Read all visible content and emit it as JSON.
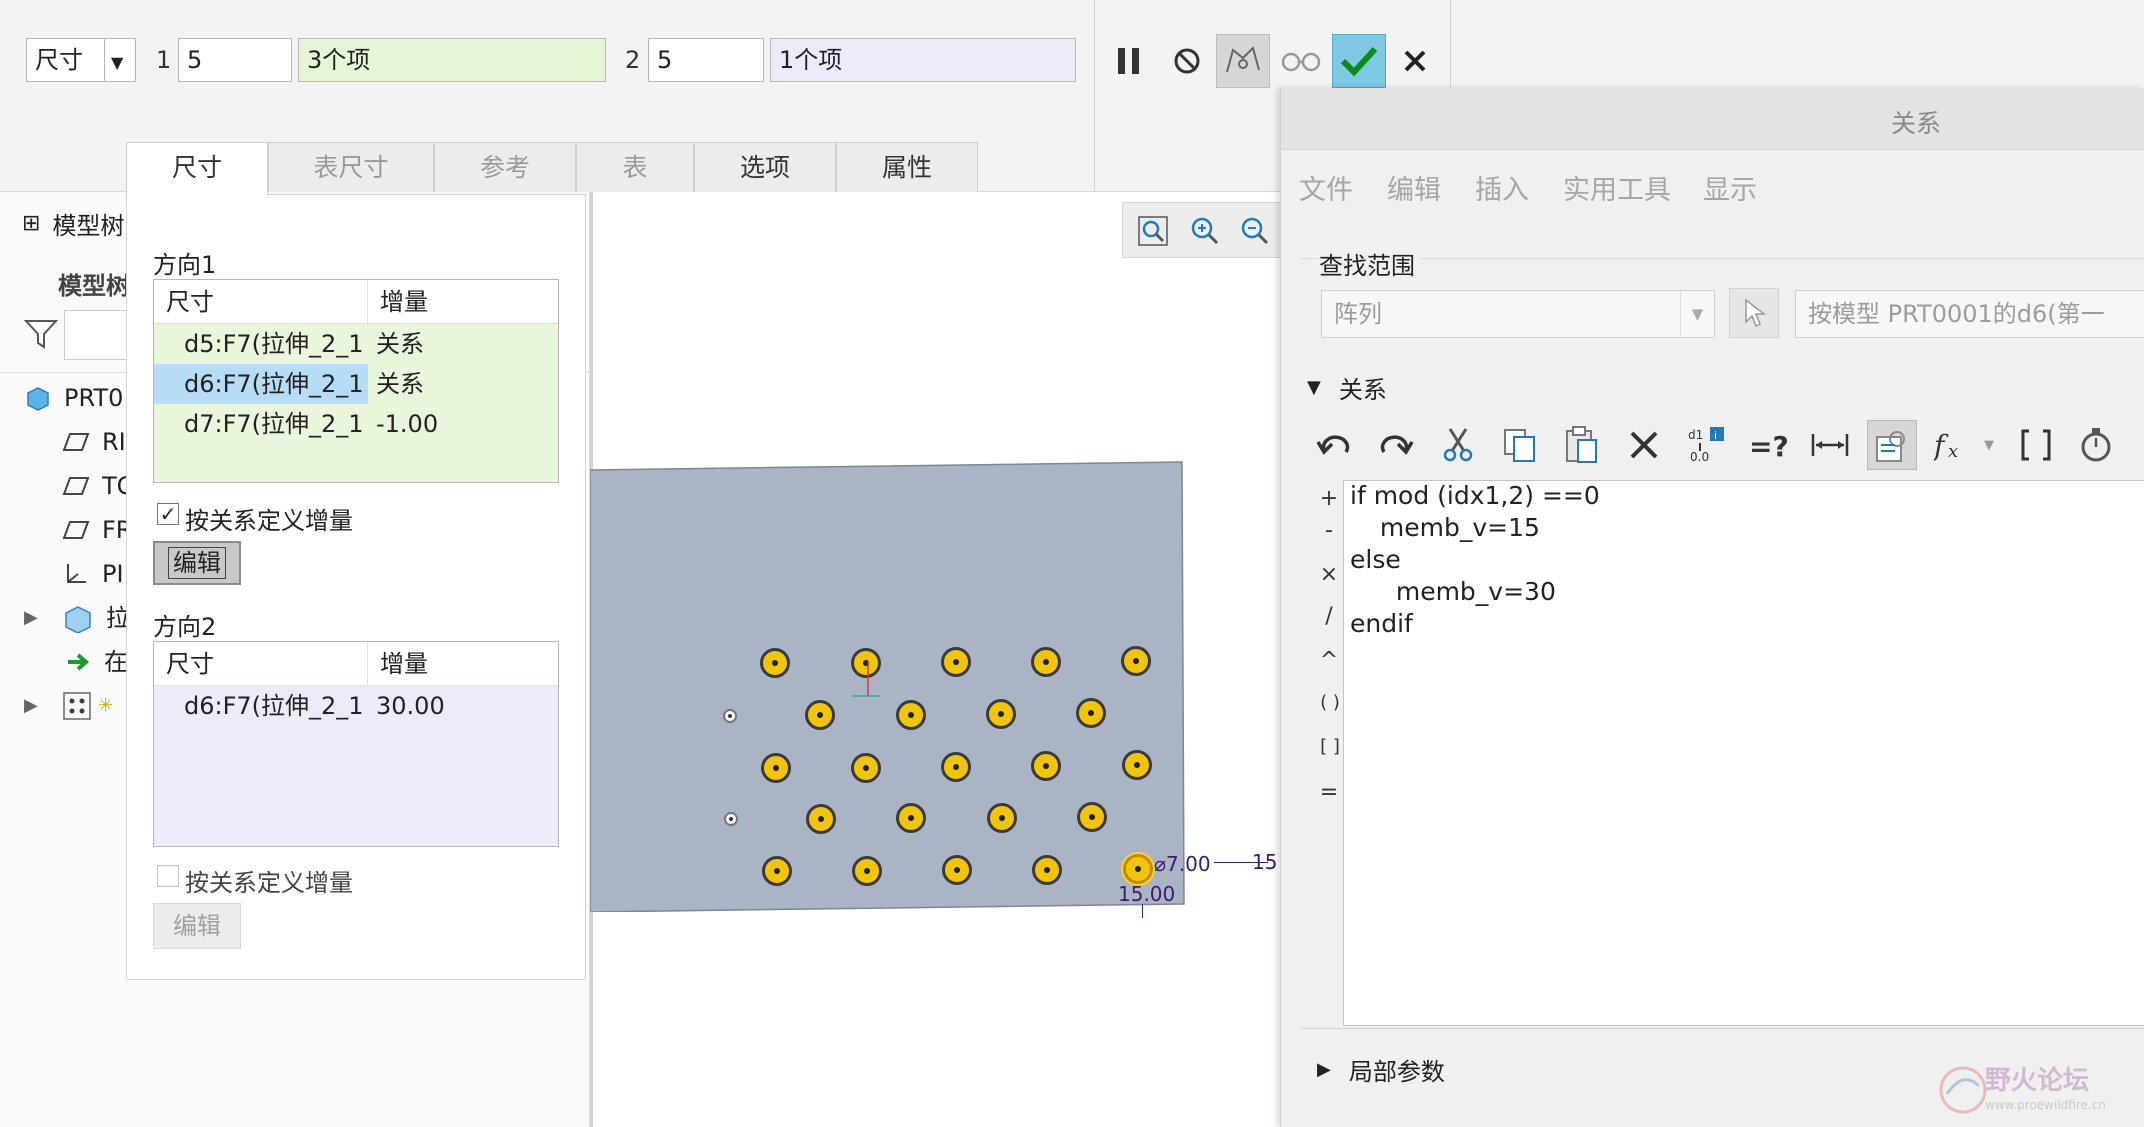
{
  "dashboard": {
    "type_label": "尺寸",
    "dir1_num": "1",
    "dir1_count": "5",
    "dir1_items": "3个项",
    "dir2_num": "2",
    "dir2_count": "5",
    "dir2_items": "1个项",
    "colors": {
      "dir1_bg": "#e6f5d6",
      "dir2_bg": "#ecebfa",
      "accept": "#7ec8e3"
    }
  },
  "tabs": [
    {
      "label": "尺寸"
    },
    {
      "label": "表尺寸"
    },
    {
      "label": "参考"
    },
    {
      "label": "表"
    },
    {
      "label": "选项"
    },
    {
      "label": "属性"
    }
  ],
  "tree": {
    "title": "模型树",
    "header": "模型树",
    "items": [
      {
        "label": "PRT0"
      },
      {
        "label": "RI"
      },
      {
        "label": "TO"
      },
      {
        "label": "FR"
      },
      {
        "label": "PI"
      },
      {
        "label": "拉"
      },
      {
        "label": "在"
      },
      {
        "label": ""
      }
    ]
  },
  "dimpanel": {
    "dir1": {
      "title": "方向1",
      "col_dim": "尺寸",
      "col_inc": "增量",
      "rows": [
        {
          "dim": "d5:F7(拉伸_2_1",
          "inc": "关系"
        },
        {
          "dim": "d6:F7(拉伸_2_1",
          "inc": "关系"
        },
        {
          "dim": "d7:F7(拉伸_2_1",
          "inc": "-1.00"
        }
      ],
      "check_label": "按关系定义增量",
      "edit_label": "编辑"
    },
    "dir2": {
      "title": "方向2",
      "col_dim": "尺寸",
      "col_inc": "增量",
      "rows": [
        {
          "dim": "d6:F7(拉伸_2_1",
          "inc": "30.00"
        }
      ],
      "check_label": "按关系定义增量",
      "edit_label": "编辑"
    }
  },
  "graphics": {
    "dim_dia": "⌀7.00",
    "dim_h": "15.00",
    "dim_right": "15"
  },
  "relations": {
    "title": "关系",
    "menu": [
      "文件",
      "编辑",
      "插入",
      "实用工具",
      "显示"
    ],
    "find_scope_label": "查找范围",
    "scope_select": "阵列",
    "scope_value": "按模型 PRT0001的d6(第一",
    "section_label": "关系",
    "code_lines": [
      "if mod (idx1,2) ==0",
      "  memb_v=15",
      "else",
      "   memb_v=30",
      "endif"
    ],
    "side_ops": [
      "+",
      "-",
      "×",
      "/",
      "^",
      "( )",
      "[ ]",
      "="
    ],
    "local_params_label": "局部参数",
    "watermark_cn": "野火论坛",
    "watermark_en": "www.proewildfire.cn"
  }
}
